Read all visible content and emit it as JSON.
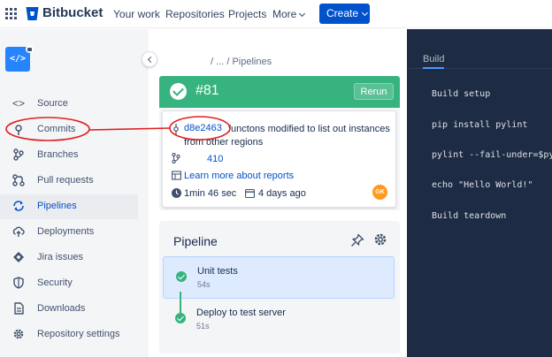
{
  "topnav": {
    "app_name": "Bitbucket",
    "links": [
      "Your work",
      "Repositories",
      "Projects",
      "More"
    ],
    "create_label": "Create"
  },
  "sidebar": {
    "avatar_glyph": "</>",
    "items": [
      {
        "label": "Source",
        "icon": "code-icon"
      },
      {
        "label": "Commits",
        "icon": "commit-icon"
      },
      {
        "label": "Branches",
        "icon": "branch-icon"
      },
      {
        "label": "Pull requests",
        "icon": "pull-request-icon"
      },
      {
        "label": "Pipelines",
        "icon": "pipelines-icon",
        "active": true
      },
      {
        "label": "Deployments",
        "icon": "cloud-upload-icon"
      },
      {
        "label": "Jira issues",
        "icon": "jira-icon"
      },
      {
        "label": "Security",
        "icon": "shield-icon"
      },
      {
        "label": "Downloads",
        "icon": "document-icon"
      },
      {
        "label": "Repository settings",
        "icon": "gear-icon"
      }
    ]
  },
  "breadcrumb": "/  ...  /  Pipelines",
  "build": {
    "number": "#81",
    "rerun_label": "Rerun",
    "status_color": "#36b37e",
    "commit_hash": "d8e2463",
    "commit_message": "functons modified to list out instances from other regions",
    "pr_number": "410",
    "learn_more": "Learn more about reports",
    "duration": "1min 46 sec",
    "age": "4 days ago",
    "author_initials": "GK"
  },
  "pipeline": {
    "title": "Pipeline",
    "steps": [
      {
        "name": "Unit tests",
        "duration": "54s"
      },
      {
        "name": "Deploy to test server",
        "duration": "51s"
      }
    ]
  },
  "log_panel": {
    "tab_label": "Build",
    "lines": [
      "Build setup",
      "pip install pylint",
      "pylint --fail-under=$py",
      "echo \"Hello World!\"",
      "Build teardown"
    ]
  },
  "annotation_color": "#e02020"
}
